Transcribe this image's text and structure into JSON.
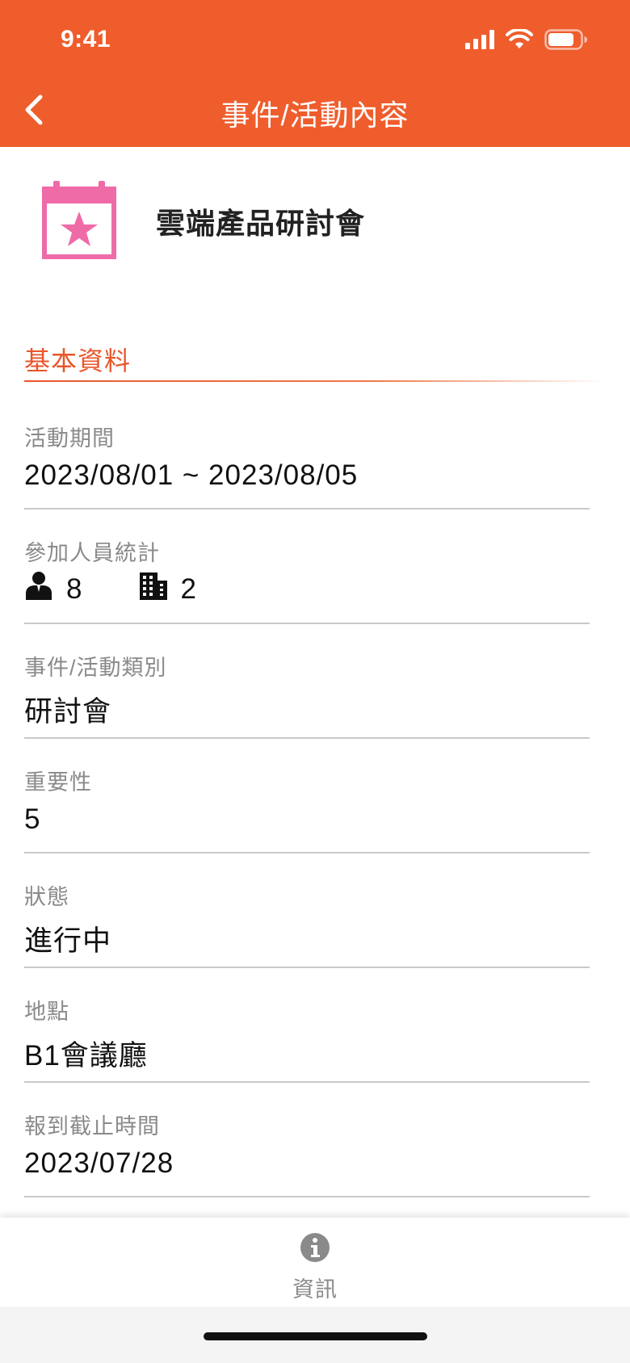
{
  "status_bar": {
    "time": "9:41"
  },
  "nav": {
    "title": "事件/活動內容"
  },
  "event": {
    "name": "雲端產品研討會",
    "icon_color": "#ef6ba8"
  },
  "section": {
    "title": "基本資料"
  },
  "fields": {
    "period": {
      "label": "活動期間",
      "value": "2023/08/01 ~ 2023/08/05"
    },
    "participants": {
      "label": "參加人員統計",
      "people_count": "8",
      "company_count": "2"
    },
    "category": {
      "label": "事件/活動類別",
      "value": "研討會"
    },
    "importance": {
      "label": "重要性",
      "value": "5"
    },
    "status": {
      "label": "狀態",
      "value": "進行中"
    },
    "location": {
      "label": "地點",
      "value": "B1會議廳"
    },
    "deadline": {
      "label": "報到截止時間",
      "value": "2023/07/28"
    }
  },
  "tabbar": {
    "info_label": "資訊"
  },
  "colors": {
    "brand": "#ef5d2d",
    "accent": "#e8562a",
    "muted": "#8a8a8a"
  }
}
